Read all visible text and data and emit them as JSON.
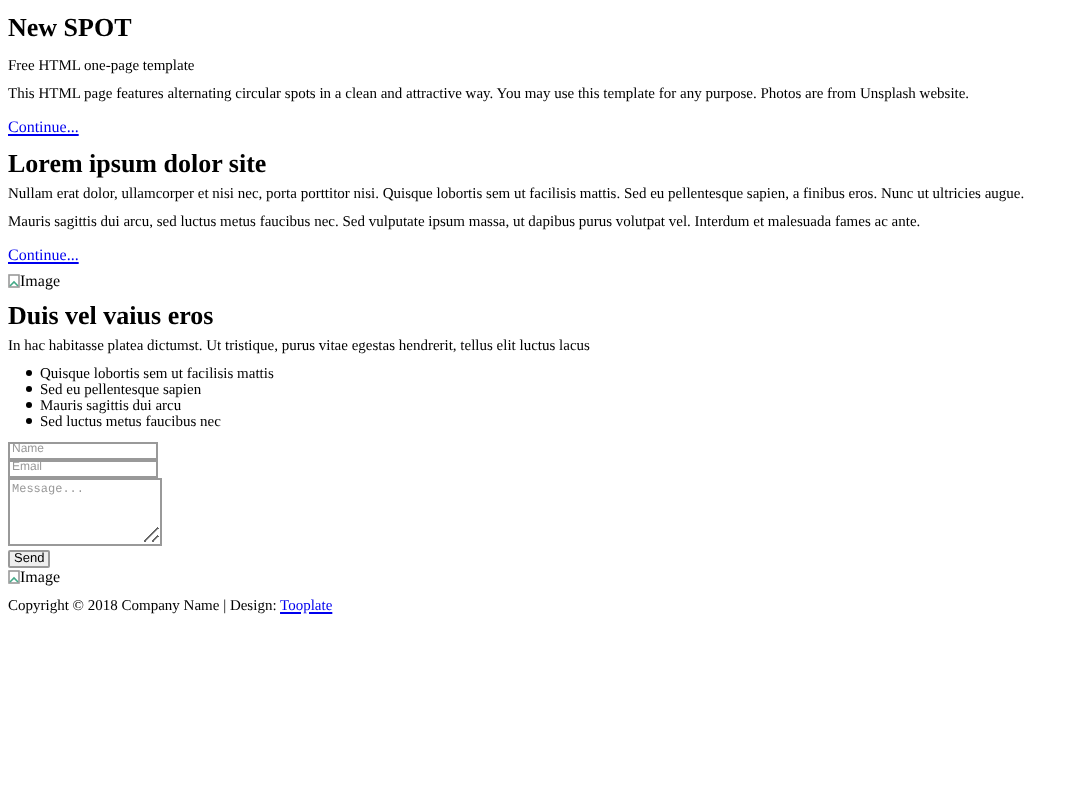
{
  "header": {
    "title": "New SPOT",
    "subtitle": "Free HTML one-page template",
    "text": "This HTML page features alternating circular spots in a clean and attractive way. You may use this template for any purpose. Photos are from Unsplash website.",
    "link": "Continue..."
  },
  "section_1": {
    "title": "Lorem ipsum dolor site",
    "paragraphs": [
      "Nullam erat dolor, ullamcorper et nisi nec, porta porttitor nisi. Quisque lobortis sem ut facilisis mattis. Sed eu pellentesque sapien, a finibus eros. Nunc ut ultricies augue.",
      "Mauris sagittis dui arcu, sed luctus metus faucibus nec. Sed vulputate ipsum massa, ut dapibus purus volutpat vel. Interdum et malesuada fames ac ante."
    ],
    "link": "Continue...",
    "image_alt": "Image"
  },
  "section_2": {
    "title": "Duis vel vaius eros",
    "text": "In hac habitasse platea dictumst. Ut tristique, purus vitae egestas hendrerit, tellus elit luctus lacus",
    "items": [
      "Quisque lobortis sem ut facilisis mattis",
      "Sed eu pellentesque sapien",
      "Mauris sagittis dui arcu",
      "Sed luctus metus faucibus nec"
    ]
  },
  "form": {
    "name_placeholder": "Name",
    "email_placeholder": "Email",
    "message_placeholder": "Message...",
    "send": "Send"
  },
  "footer": {
    "image_alt": "Image",
    "copyright": "Copyright © 2018 Company Name | Design: ",
    "link": "Tooplate"
  }
}
